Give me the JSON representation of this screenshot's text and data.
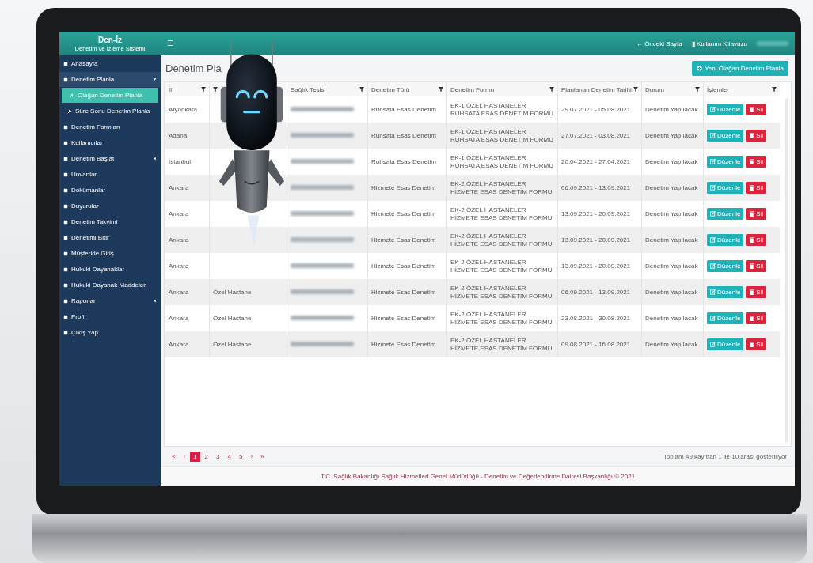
{
  "app": {
    "logo": "Den-İz",
    "subtitle": "Denetim ve İzleme Sistemi"
  },
  "topbar": {
    "menu_glyph": "☰",
    "links": [
      {
        "glyph": "←",
        "label": "Önceki Sayfa"
      },
      {
        "glyph": "▮",
        "label": "Kullanım Kılavuzu"
      }
    ]
  },
  "sidebar": {
    "items": [
      {
        "label": "Anasayfa",
        "selected": false
      },
      {
        "label": "Denetim Planla",
        "selected": false,
        "expanded": true,
        "children": [
          {
            "label": "Olağan Denetim Planla",
            "selected": true
          },
          {
            "label": "Süre Sonu Denetim Planla",
            "selected": false
          }
        ]
      },
      {
        "label": "Denetim Formları",
        "selected": false
      },
      {
        "label": "Kullanıcılar",
        "selected": false
      },
      {
        "label": "Denetim Başlat",
        "selected": false,
        "expanded": false
      },
      {
        "label": "Unvanlar",
        "selected": false
      },
      {
        "label": "Dokümanlar",
        "selected": false
      },
      {
        "label": "Duyurular",
        "selected": false
      },
      {
        "label": "Denetim Takvimi",
        "selected": false
      },
      {
        "label": "Denetimi Bitir",
        "selected": false
      },
      {
        "label": "Müşteride Giriş",
        "selected": false
      },
      {
        "label": "Hukuki Dayanaklar",
        "selected": false
      },
      {
        "label": "Hukuki Dayanak Maddeleri",
        "selected": false
      },
      {
        "label": "Raporlar",
        "selected": false,
        "expanded": false
      },
      {
        "label": "Profil",
        "selected": false
      },
      {
        "label": "Çıkış Yap",
        "selected": false
      }
    ]
  },
  "page": {
    "title": "Denetim Pla",
    "new_button": "Yeni Olağan Denetim Planla"
  },
  "table": {
    "columns": [
      {
        "label": "İl"
      },
      {},
      {
        "label": "Sağlık Tesisi"
      },
      {
        "label": "Denetim Türü"
      },
      {
        "label": "Denetim Formu"
      },
      {
        "label": "Planlanan Denetim Tarihi"
      },
      {
        "label": "Durum"
      },
      {
        "label": "İşlemler"
      }
    ],
    "rows": [
      {
        "city": "Afyonkara",
        "audit_type": "Ruhsata Esas Denetim",
        "form": "EK-1 ÖZEL HASTANELER RUHSATA ESAS DENETİM FORMU",
        "dates": "29.07.2021 - 05.08.2021",
        "status": "Denetim Yapılacak",
        "edit": "Düzenle",
        "delete": "Sil"
      },
      {
        "city": "Adana",
        "audit_type": "Ruhsata Esas Denetim",
        "form": "EK-1 ÖZEL HASTANELER RUHSATA ESAS DENETİM FORMU",
        "dates": "27.07.2021 - 03.08.2021",
        "status": "Denetim Yapılacak",
        "edit": "Düzenle",
        "delete": "Sil"
      },
      {
        "city": "İstanbul",
        "audit_type": "Ruhsata Esas Denetim",
        "form": "EK-1 ÖZEL HASTANELER RUHSATA ESAS DENETİM FORMU",
        "dates": "20.04.2021 - 27.04.2021",
        "status": "Denetim Yapılacak",
        "edit": "Düzenle",
        "delete": "Sil"
      },
      {
        "city": "Ankara",
        "audit_type": "Hizmete Esas Denetim",
        "form": "EK-2 ÖZEL HASTANELER HİZMETE ESAS DENETİM FORMU",
        "dates": "06.09.2021 - 13.09.2021",
        "status": "Denetim Yapılacak",
        "edit": "Düzenle",
        "delete": "Sil"
      },
      {
        "city": "Ankara",
        "audit_type": "Hizmete Esas Denetim",
        "form": "EK-2 ÖZEL HASTANELER HİZMETE ESAS DENETİM FORMU",
        "dates": "13.09.2021 - 20.09.2021",
        "status": "Denetim Yapılacak",
        "edit": "Düzenle",
        "delete": "Sil"
      },
      {
        "city": "Ankara",
        "audit_type": "Hizmete Esas Denetim",
        "form": "EK-2 ÖZEL HASTANELER HİZMETE ESAS DENETİM FORMU",
        "dates": "13.09.2021 - 20.09.2021",
        "status": "Denetim Yapılacak",
        "edit": "Düzenle",
        "delete": "Sil"
      },
      {
        "city": "Ankara",
        "audit_type": "Hizmete Esas Denetim",
        "form": "EK-2 ÖZEL HASTANELER HİZMETE ESAS DENETİM FORMU",
        "dates": "13.09.2021 - 20.09.2021",
        "status": "Denetim Yapılacak",
        "edit": "Düzenle",
        "delete": "Sil"
      },
      {
        "city": "Ankara",
        "facility_type": "Özel Hastane",
        "audit_type": "Hizmete Esas Denetim",
        "form": "EK-2 ÖZEL HASTANELER HİZMETE ESAS DENETİM FORMU",
        "dates": "06.09.2021 - 13.09.2021",
        "status": "Denetim Yapılacak",
        "edit": "Düzenle",
        "delete": "Sil"
      },
      {
        "city": "Ankara",
        "facility_type": "Özel Hastane",
        "audit_type": "Hizmete Esas Denetim",
        "form": "EK-2 ÖZEL HASTANELER HİZMETE ESAS DENETİM FORMU",
        "dates": "23.08.2021 - 30.08.2021",
        "status": "Denetim Yapılacak",
        "edit": "Düzenle",
        "delete": "Sil"
      },
      {
        "city": "Ankara",
        "facility_type": "Özel Hastane",
        "audit_type": "Hizmete Esas Denetim",
        "form": "EK-2 ÖZEL HASTANELER HİZMETE ESAS DENETİM FORMU",
        "dates": "09.08.2021 - 16.08.2021",
        "status": "Denetim Yapılacak",
        "edit": "Düzenle",
        "delete": "Sil"
      }
    ]
  },
  "pagination": {
    "first": "«",
    "prev": "‹",
    "pages": [
      {
        "label": "1",
        "selected": true
      },
      {
        "label": "2",
        "selected": false
      },
      {
        "label": "3",
        "selected": false
      },
      {
        "label": "4",
        "selected": false
      },
      {
        "label": "5",
        "selected": false
      }
    ],
    "next": "›",
    "last": "»",
    "info": "Toplam 49 kayıttan 1 ile 10 arası gösteriliyor"
  },
  "footer": "T.C. Sağlık Bakanlığı Sağlık Hizmetleri Genel Müdürlüğü - Denetim ve Değerlendirme Dairesi Başkanlığı © 2021"
}
